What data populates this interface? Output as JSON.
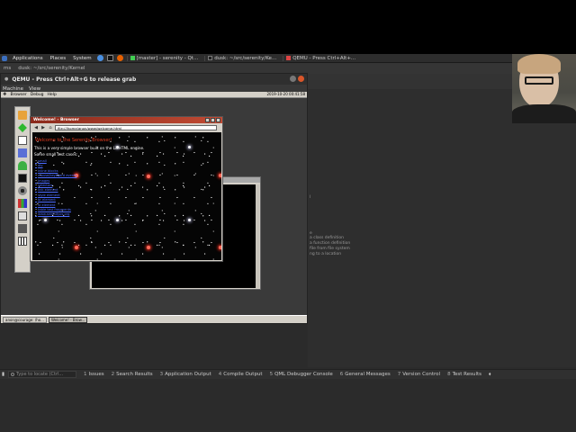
{
  "gnome_panel": {
    "menus": [
      "Applications",
      "Places",
      "System"
    ],
    "tasks": [
      "[master] - serenity - Qt...",
      "dusk: ~/src/serenity/Ke...",
      "QEMU - Press Ctrl+Alt+..."
    ]
  },
  "terminal_path": "dusk: ~/src/serenity/Kernel",
  "terminal_prefix": "ms",
  "qemu": {
    "title": "QEMU - Press Ctrl+Alt+G to release grab",
    "menu": [
      "Machine",
      "View"
    ]
  },
  "serenity": {
    "top_menu": [
      "Browser",
      "Debug",
      "Help"
    ],
    "clock": "2019-10-20 00:41:58",
    "taskbar": [
      "anon@courage: /ho...",
      "Welcome! - Brow..."
    ]
  },
  "browser": {
    "title": "Welcome! - Browser",
    "nav": [
      "◀",
      "▶",
      "⌂"
    ],
    "url": "file:///home/anon/www/welcome.html",
    "heading": "Welcome to the Serenity Browser!",
    "line1": "This is a very simple browser built on the LibHTML engine.",
    "line2": "Some small test cases:",
    "links": [
      "small",
      "div",
      "inline blocks",
      "mouse/keyboard events",
      "images",
      "selectors",
      "link element",
      "style element",
      "br element",
      "ul element",
      "table test fragments",
      "www.serenityos.org"
    ]
  },
  "ide": {
    "side_texts": [
      "l",
      "e",
      "a class definition",
      "a function definition",
      "file from file system",
      "ng to a location"
    ],
    "status": {
      "locator_placeholder": "Type to locate (Ctrl...",
      "panes": [
        {
          "num": "1",
          "label": "Issues"
        },
        {
          "num": "2",
          "label": "Search Results"
        },
        {
          "num": "3",
          "label": "Application Output"
        },
        {
          "num": "4",
          "label": "Compile Output"
        },
        {
          "num": "5",
          "label": "QML Debugger Console"
        },
        {
          "num": "6",
          "label": "General Messages"
        },
        {
          "num": "7",
          "label": "Version Control"
        },
        {
          "num": "8",
          "label": "Test Results"
        }
      ]
    }
  },
  "colors": {
    "accent_red": "#e23a1e",
    "link_blue": "#4a6aff",
    "close_orange": "#d9562a"
  }
}
